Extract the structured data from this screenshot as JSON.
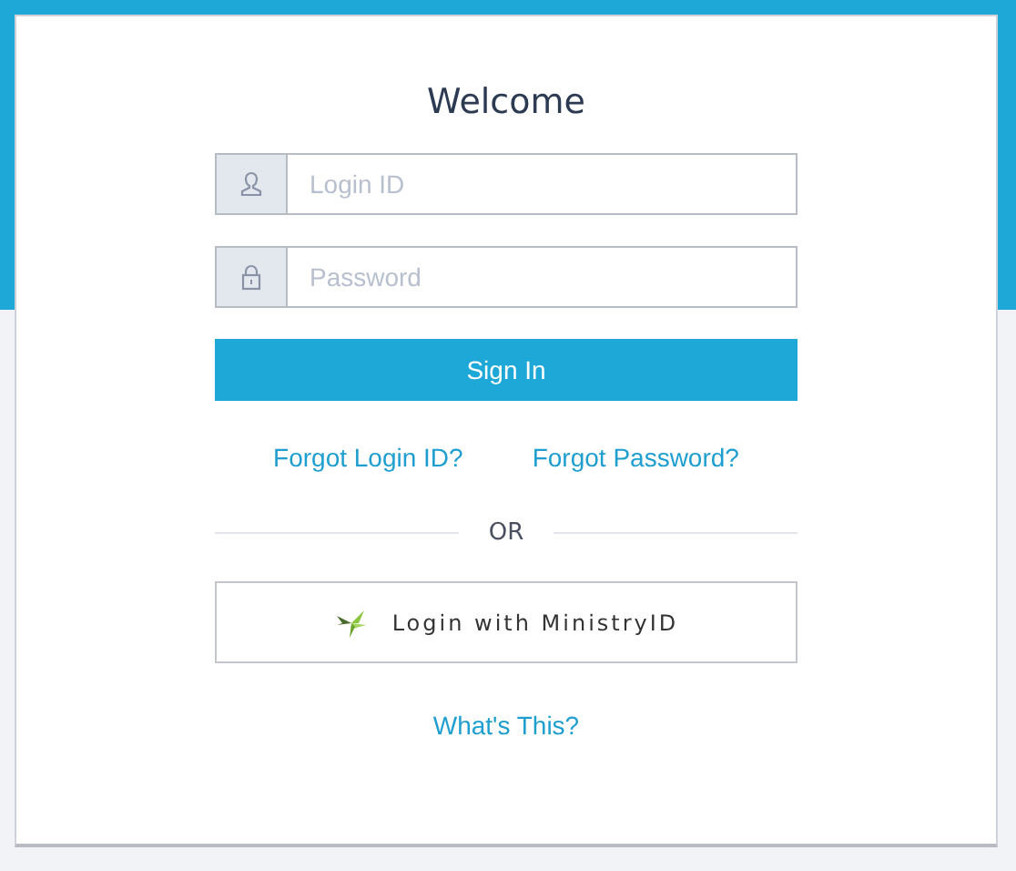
{
  "title": "Welcome",
  "fields": [
    {
      "kind": "user",
      "placeholder": "Login ID"
    },
    {
      "kind": "lock",
      "placeholder": "Password"
    }
  ],
  "sign_in_button": "Sign In",
  "links": [
    "Forgot Login ID?",
    "Forgot Password?"
  ],
  "divider_text": "OR",
  "ministry_button": "Login with MinistryID",
  "whats_this_link": "What's This?"
}
